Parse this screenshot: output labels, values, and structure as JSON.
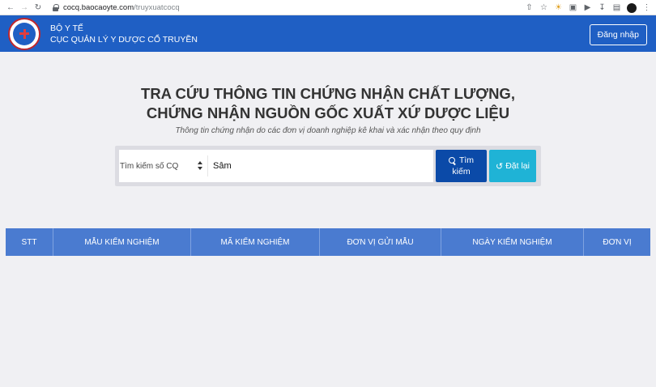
{
  "browser": {
    "url_host": "cocq.baocaoyte.com",
    "url_path": "/truyxuatcocq"
  },
  "header": {
    "org_line1": "BỘ Y TẾ",
    "org_line2": "CỤC QUẢN LÝ Y DƯỢC CỔ TRUYỀN",
    "login_label": "Đăng nhập"
  },
  "page": {
    "title_line1": "TRA CỨU THÔNG TIN CHỨNG NHẬN CHẤT LƯỢNG,",
    "title_line2": "CHỨNG NHẬN NGUỒN GỐC XUẤT XỨ DƯỢC LIỆU",
    "subtitle": "Thông tin chứng nhận do các đơn vị doanh nghiệp kê khai và xác nhận theo quy định"
  },
  "search": {
    "select_value": "Tìm kiếm số CQ",
    "query_value": "Sâm",
    "search_label_line1": "Tìm",
    "search_label_line2": "kiếm",
    "reset_label": "Đặt lại"
  },
  "table": {
    "columns": [
      "STT",
      "MẪU KIỂM NGHIỆM",
      "MÃ KIỂM NGHIỆM",
      "ĐƠN VỊ GỬI MẪU",
      "NGÀY KIỂM NGHIỆM",
      "ĐƠN VỊ"
    ]
  },
  "colors": {
    "header_blue": "#1f5fc4",
    "search_btn": "#0b4aa8",
    "reset_btn": "#1fb3d6",
    "table_head": "#4a7bd0"
  }
}
